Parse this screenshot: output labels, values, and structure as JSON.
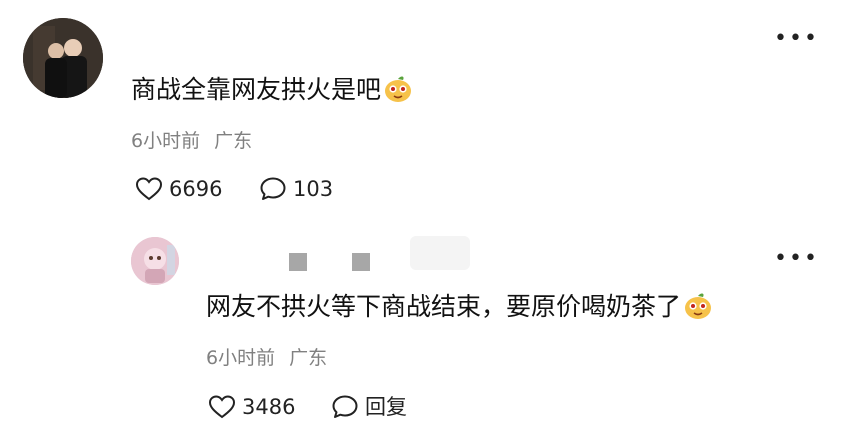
{
  "comment": {
    "text": "商战全靠网友拱火是吧",
    "time": "6小时前",
    "location": "广东",
    "likes": "6696",
    "replies": "103",
    "more_icon": "more-dots-icon",
    "emoji": "mango-face-emoji"
  },
  "reply": {
    "text": "网友不拱火等下商战结束，要原价喝奶茶了",
    "time": "6小时前",
    "location": "广东",
    "likes": "3486",
    "reply_label": "回复",
    "more_icon": "more-dots-icon",
    "emoji": "mango-face-emoji"
  },
  "colors": {
    "text": "#111111",
    "meta": "#808080",
    "icon": "#222222",
    "redaction": "#a7a7a7"
  }
}
